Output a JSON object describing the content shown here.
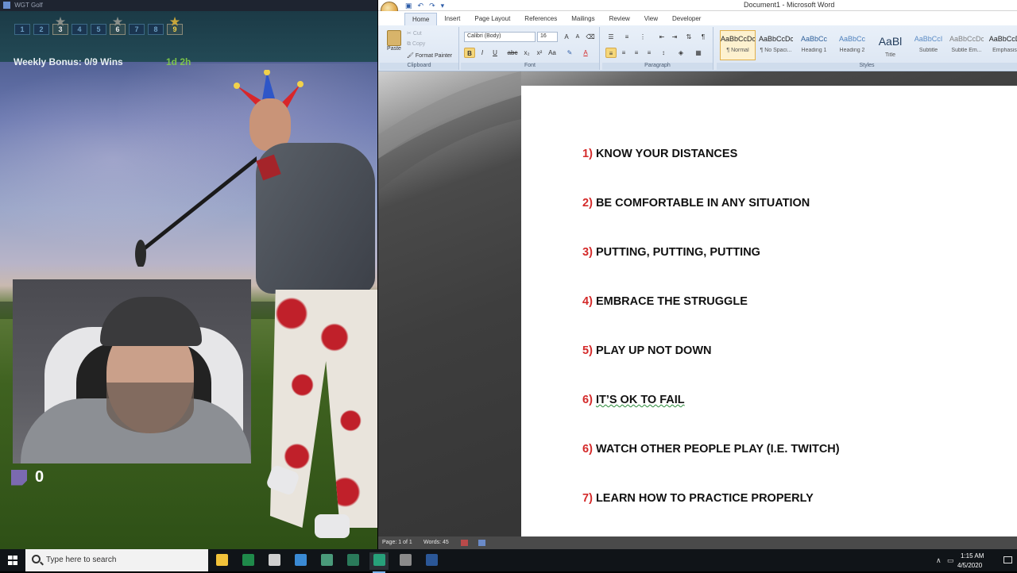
{
  "game": {
    "window_title": "WGT Golf",
    "holes": [
      {
        "label": "1",
        "star": false,
        "gold": false
      },
      {
        "label": "2",
        "star": false,
        "gold": false
      },
      {
        "label": "3",
        "star": true,
        "gold": false
      },
      {
        "label": "4",
        "star": false,
        "gold": false
      },
      {
        "label": "5",
        "star": false,
        "gold": false
      },
      {
        "label": "6",
        "star": true,
        "gold": false
      },
      {
        "label": "7",
        "star": false,
        "gold": false
      },
      {
        "label": "8",
        "star": false,
        "gold": false
      },
      {
        "label": "9",
        "star": true,
        "gold": true
      }
    ],
    "weekly_bonus": "Weekly Bonus: 0/9 Wins",
    "time_left": "1d 2h",
    "twitch_count": "0"
  },
  "word": {
    "window_title": "Document1 - Microsoft Word",
    "tabs": [
      {
        "label": "Home",
        "active": true
      },
      {
        "label": "Insert",
        "active": false
      },
      {
        "label": "Page Layout",
        "active": false
      },
      {
        "label": "References",
        "active": false
      },
      {
        "label": "Mailings",
        "active": false
      },
      {
        "label": "Review",
        "active": false
      },
      {
        "label": "View",
        "active": false
      },
      {
        "label": "Developer",
        "active": false
      }
    ],
    "clipboard": {
      "paste": "Paste",
      "cut": "Cut",
      "copy": "Copy",
      "format_painter": "Format Painter",
      "group_label": "Clipboard"
    },
    "font": {
      "name": "Calibri (Body)",
      "size": "16",
      "group_label": "Font"
    },
    "paragraph": {
      "group_label": "Paragraph"
    },
    "styles": {
      "group_label": "Styles",
      "items": [
        {
          "sample": "AaBbCcDc",
          "name": "¶ Normal",
          "selected": true,
          "color": "#222222"
        },
        {
          "sample": "AaBbCcDc",
          "name": "¶ No Spaci...",
          "selected": false,
          "color": "#222222"
        },
        {
          "sample": "AaBbCc",
          "name": "Heading 1",
          "selected": false,
          "color": "#2e5f9a"
        },
        {
          "sample": "AaBbCc",
          "name": "Heading 2",
          "selected": false,
          "color": "#4f81bd"
        },
        {
          "sample": "AaBl",
          "name": "Title",
          "selected": false,
          "color": "#1f3a5a"
        },
        {
          "sample": "AaBbCcI",
          "name": "Subtitle",
          "selected": false,
          "color": "#5b8bc5"
        },
        {
          "sample": "AaBbCcDc",
          "name": "Subtle Em...",
          "selected": false,
          "color": "#808080"
        },
        {
          "sample": "AaBbCcD",
          "name": "Emphasis",
          "selected": false,
          "color": "#222222"
        }
      ]
    },
    "tips": [
      {
        "num": "1)",
        "text": "KNOW YOUR DISTANCES",
        "spell": false
      },
      {
        "num": "2)",
        "text": "BE COMFORTABLE IN ANY SITUATION",
        "spell": false
      },
      {
        "num": "3)",
        "text": "PUTTING, PUTTING, PUTTING",
        "spell": false
      },
      {
        "num": "4)",
        "text": "EMBRACE THE STRUGGLE",
        "spell": false
      },
      {
        "num": "5)",
        "text": "PLAY UP NOT DOWN",
        "spell": false
      },
      {
        "num": "6)",
        "text": "IT’S OK TO FAIL",
        "spell": true
      },
      {
        "num": "6)",
        "text": "WATCH OTHER PEOPLE PLAY (I.E. TWITCH)",
        "spell": false
      },
      {
        "num": "7)",
        "text": "LEARN HOW TO PRACTICE PROPERLY",
        "spell": false
      }
    ],
    "status": {
      "page": "Page: 1 of 1",
      "words": "Words: 45"
    }
  },
  "taskbar": {
    "search_placeholder": "Type here to search",
    "apps": [
      {
        "name": "file-explorer-icon",
        "color": "#f2c23a",
        "active": false
      },
      {
        "name": "excel-icon",
        "color": "#1f8a4a",
        "active": false
      },
      {
        "name": "calculator-icon",
        "color": "#cfcfcf",
        "active": false
      },
      {
        "name": "app-icon",
        "color": "#3a8ad4",
        "active": false
      },
      {
        "name": "game-controller-icon",
        "color": "#4a9a7a",
        "active": false
      },
      {
        "name": "spreadsheet-icon",
        "color": "#2a7a5a",
        "active": false
      },
      {
        "name": "obs-icon",
        "color": "#27a07a",
        "active": true
      },
      {
        "name": "browser-icon",
        "color": "#8a8a8a",
        "active": false
      },
      {
        "name": "word-icon",
        "color": "#2b5797",
        "active": false
      }
    ],
    "clock_time": "1:15 AM",
    "clock_date": "4/5/2020"
  }
}
